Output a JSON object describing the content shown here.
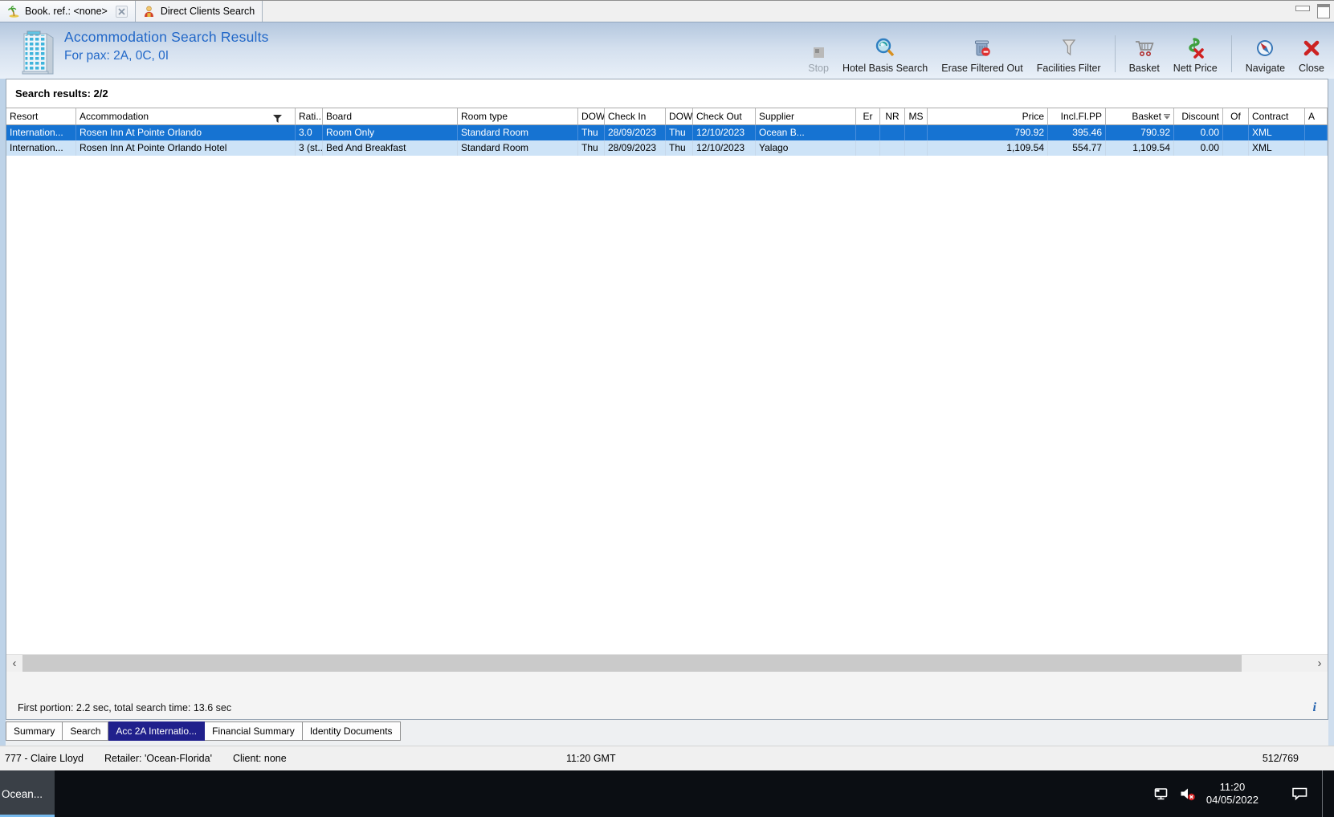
{
  "colors": {
    "selected_row": "#1673d2",
    "row_alt": "#cde3f7",
    "title_text": "#2268c8",
    "selected_tab": "#20208c",
    "banner_top": "#b4c7de",
    "banner_bottom": "#e9f0f8",
    "taskbar_underline": "#76b9ed",
    "close_red": "#cc2222"
  },
  "window_tabs": {
    "tab1": "Book. ref.: <none>",
    "tab2": "Direct Clients Search"
  },
  "banner": {
    "title": "Accommodation Search Results",
    "subtitle": "For pax: 2A, 0C, 0I",
    "toolbar": [
      {
        "label": "Stop",
        "disabled": true
      },
      {
        "label": "Hotel Basis Search"
      },
      {
        "label": "Erase Filtered Out"
      },
      {
        "label": "Facilities Filter"
      },
      {
        "label": "Basket"
      },
      {
        "label": "Nett Price"
      },
      {
        "label": "Navigate"
      },
      {
        "label": "Close"
      }
    ]
  },
  "results_label": "Search results: 2/2",
  "table": {
    "columns": [
      "Resort",
      "Accommodation",
      "Rati...",
      "Board",
      "Room type",
      "DOW",
      "Check In",
      "DOW",
      "Check Out",
      "Supplier",
      "Er",
      "NR",
      "MS",
      "Price",
      "Incl.Fl.PP",
      "Basket",
      "Discount",
      "Of",
      "Contract",
      "A"
    ],
    "selected_row": 0,
    "rows": [
      [
        "Internation...",
        "Rosen Inn At Pointe Orlando",
        "3.0",
        "Room Only",
        "Standard Room",
        "Thu",
        "28/09/2023",
        "Thu",
        "12/10/2023",
        "Ocean B...",
        "",
        "",
        "",
        "790.92",
        "395.46",
        "790.92",
        "0.00",
        "",
        "XML",
        ""
      ],
      [
        "Internation...",
        "Rosen Inn At Pointe Orlando Hotel",
        "3 (st...",
        "Bed And Breakfast",
        "Standard Room",
        "Thu",
        "28/09/2023",
        "Thu",
        "12/10/2023",
        "Yalago",
        "",
        "",
        "",
        "1,109.54",
        "554.77",
        "1,109.54",
        "0.00",
        "",
        "XML",
        ""
      ]
    ]
  },
  "scrollbar": {
    "left_glyph": "‹",
    "right_glyph": "›"
  },
  "footer": {
    "search_time": "First portion: 2.2 sec, total search time: 13.6 sec",
    "info_glyph": "i"
  },
  "bottom_tabs": [
    "Summary",
    "Search",
    "Acc 2A Internatio...",
    "Financial Summary",
    "Identity Documents"
  ],
  "statusbar": {
    "user": "777 - Claire Lloyd",
    "retailer": "Retailer: 'Ocean-Florida'",
    "client": "Client: none",
    "time": "11:20 GMT",
    "counter": "512/769"
  },
  "taskbar": {
    "app_label": "Ocean...",
    "tray_time": "11:20",
    "tray_date": "04/05/2022"
  }
}
